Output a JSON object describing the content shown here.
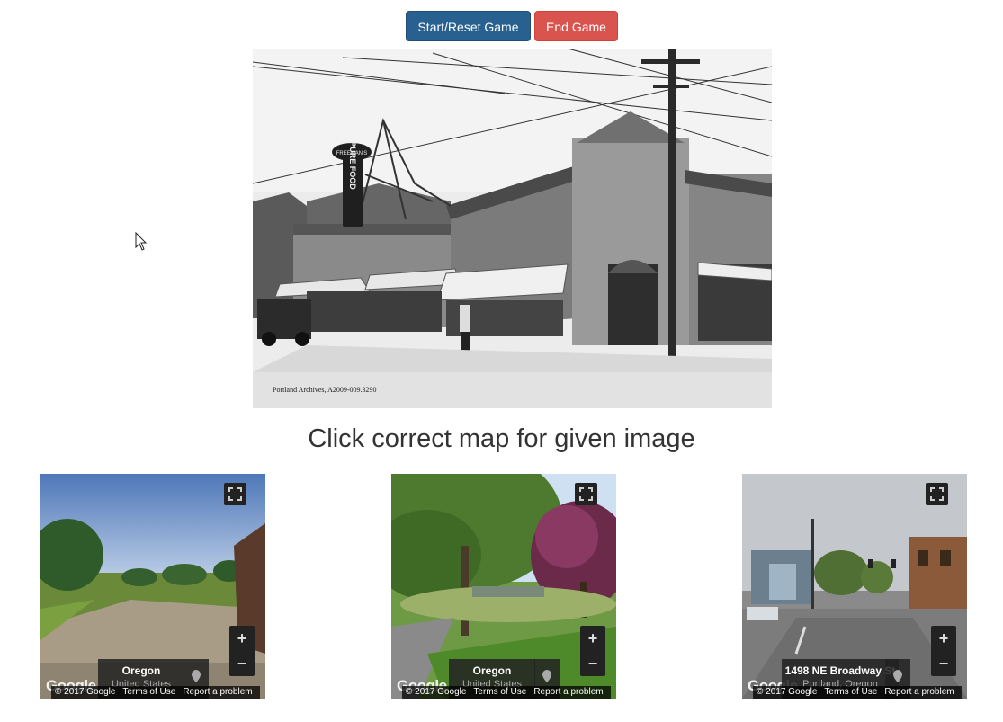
{
  "controls": {
    "start_label": "Start/Reset Game",
    "end_label": "End Game"
  },
  "photo": {
    "caption": "Portland Archives, A2009-009.3290",
    "sign_top": "FREEMAN'S",
    "sign_letters": "PURE FOOD"
  },
  "prompt": "Click correct map for given image",
  "streetviews": [
    {
      "location": "Oregon",
      "sublabel": "United States",
      "copyright": "© 2017 Google",
      "terms": "Terms of Use",
      "report": "Report a problem",
      "zoom_in": "+",
      "zoom_out": "−"
    },
    {
      "location": "Oregon",
      "sublabel": "United States",
      "copyright": "© 2017 Google",
      "terms": "Terms of Use",
      "report": "Report a problem",
      "zoom_in": "+",
      "zoom_out": "−"
    },
    {
      "location": "1498 NE Broadway St",
      "sublabel": "Portland, Oregon",
      "copyright": "© 2017 Google",
      "terms": "Terms of Use",
      "report": "Report a problem",
      "zoom_in": "+",
      "zoom_out": "−"
    }
  ],
  "google_logo": "Google",
  "colors": {
    "primary": "#286090",
    "danger": "#d9534f"
  }
}
